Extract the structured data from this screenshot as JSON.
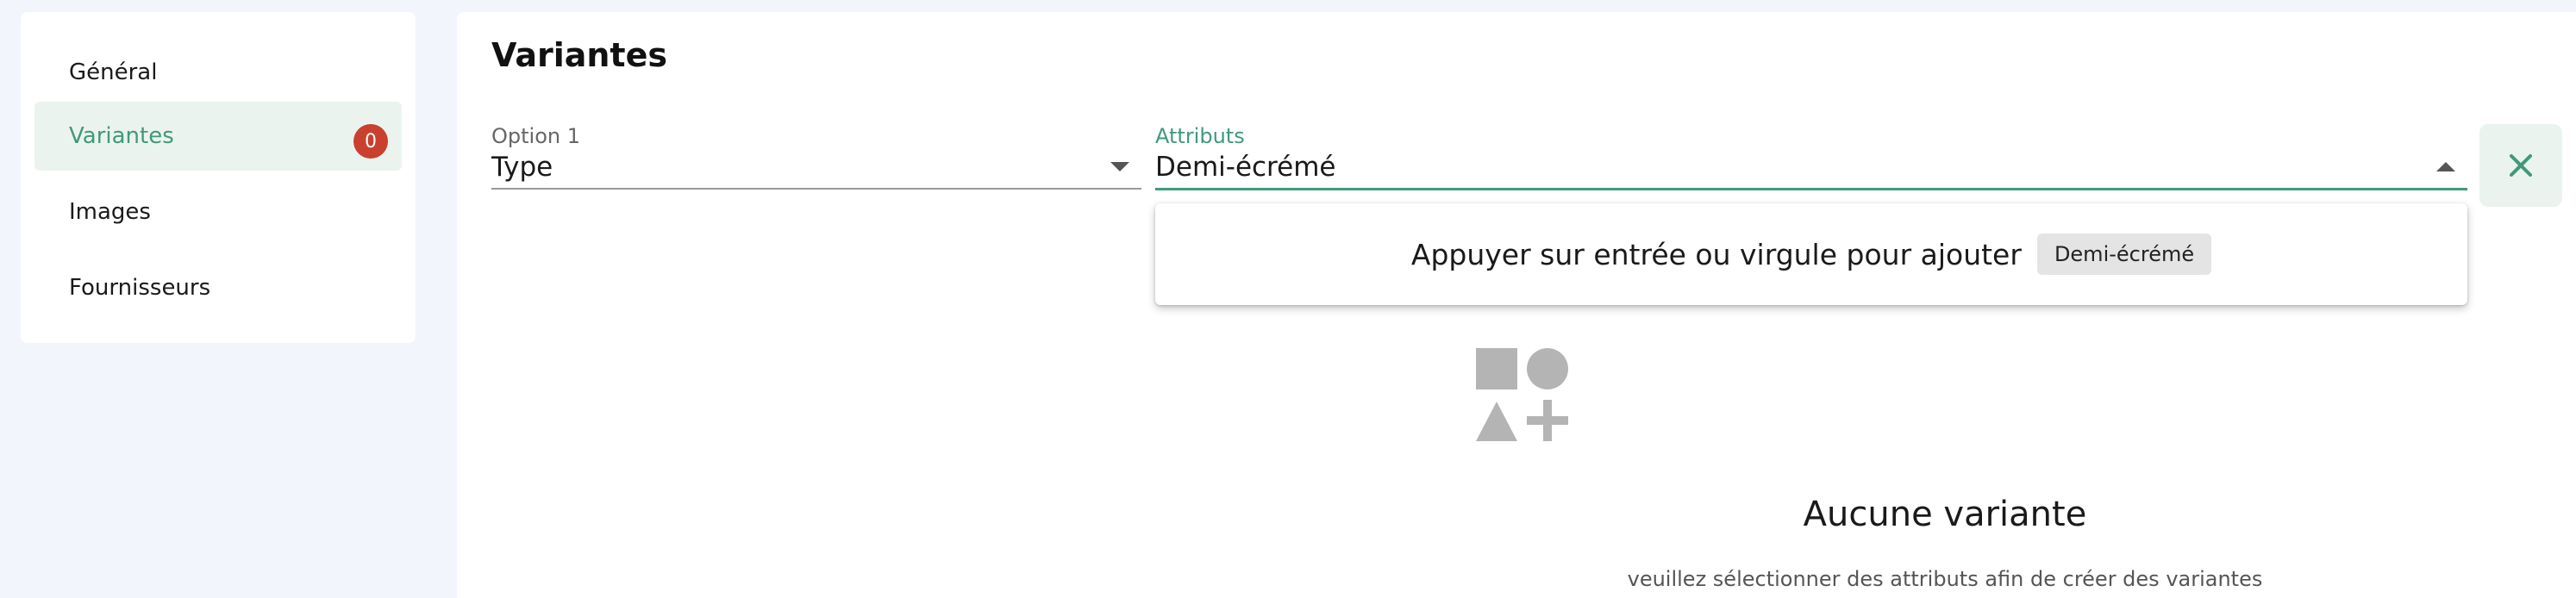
{
  "sidebar": {
    "items": [
      {
        "label": "Général",
        "active": false
      },
      {
        "label": "Variantes",
        "active": true,
        "badge": "0"
      },
      {
        "label": "Images",
        "active": false
      },
      {
        "label": "Fournisseurs",
        "active": false
      }
    ]
  },
  "main": {
    "title": "Variantes",
    "option_field": {
      "label": "Option 1",
      "value": "Type",
      "icon": "chevron-down-icon"
    },
    "attributes_field": {
      "label": "Attributs",
      "value": "Demi-écrémé",
      "icon": "chevron-up-icon"
    },
    "close_button": {
      "icon": "close-icon"
    },
    "dropdown": {
      "hint": "Appuyer sur entrée ou virgule pour ajouter",
      "chip": "Demi-écrémé"
    },
    "empty_state": {
      "icon": "shapes-icon",
      "title": "Aucune variante",
      "subtitle": "veuillez sélectionner des attributs afin de créer des variantes"
    }
  },
  "colors": {
    "accent": "#3f9a7a",
    "active_bg": "#ebf3ef",
    "badge": "#c9402f",
    "page_bg": "#f2f5fc"
  }
}
